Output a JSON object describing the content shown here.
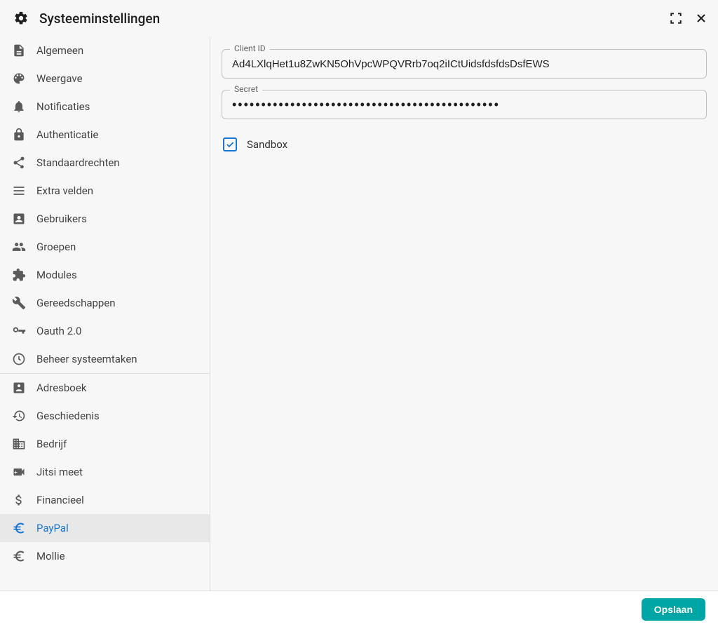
{
  "header": {
    "title": "Systeeminstellingen"
  },
  "sidebar": {
    "group1": [
      {
        "icon": "document",
        "label": "Algemeen"
      },
      {
        "icon": "palette",
        "label": "Weergave"
      },
      {
        "icon": "bell",
        "label": "Notificaties"
      },
      {
        "icon": "lock",
        "label": "Authenticatie"
      },
      {
        "icon": "share",
        "label": "Standaardrechten"
      },
      {
        "icon": "list",
        "label": "Extra velden"
      },
      {
        "icon": "user",
        "label": "Gebruikers"
      },
      {
        "icon": "group",
        "label": "Groepen"
      },
      {
        "icon": "puzzle",
        "label": "Modules"
      },
      {
        "icon": "wrench",
        "label": "Gereedschappen"
      },
      {
        "icon": "key",
        "label": "Oauth 2.0"
      },
      {
        "icon": "clock",
        "label": "Beheer systeemtaken"
      }
    ],
    "group2": [
      {
        "icon": "addressbook",
        "label": "Adresboek"
      },
      {
        "icon": "history",
        "label": "Geschiedenis"
      },
      {
        "icon": "business",
        "label": "Bedrijf"
      },
      {
        "icon": "video",
        "label": "Jitsi meet"
      },
      {
        "icon": "dollar",
        "label": "Financieel"
      },
      {
        "icon": "euro",
        "label": "PayPal",
        "active": true
      },
      {
        "icon": "euro",
        "label": "Mollie"
      }
    ]
  },
  "form": {
    "client_id_label": "Client ID",
    "client_id_value": "Ad4LXlqHet1u8ZwKN5OhVpcWPQVRrb7oq2iICtUidsfdsfdsDsfEWS",
    "secret_label": "Secret",
    "secret_value": "••••••••••••••••••••••••••••••••••••••••••••••",
    "sandbox_label": "Sandbox",
    "sandbox_checked": true
  },
  "footer": {
    "save_label": "Opslaan"
  }
}
